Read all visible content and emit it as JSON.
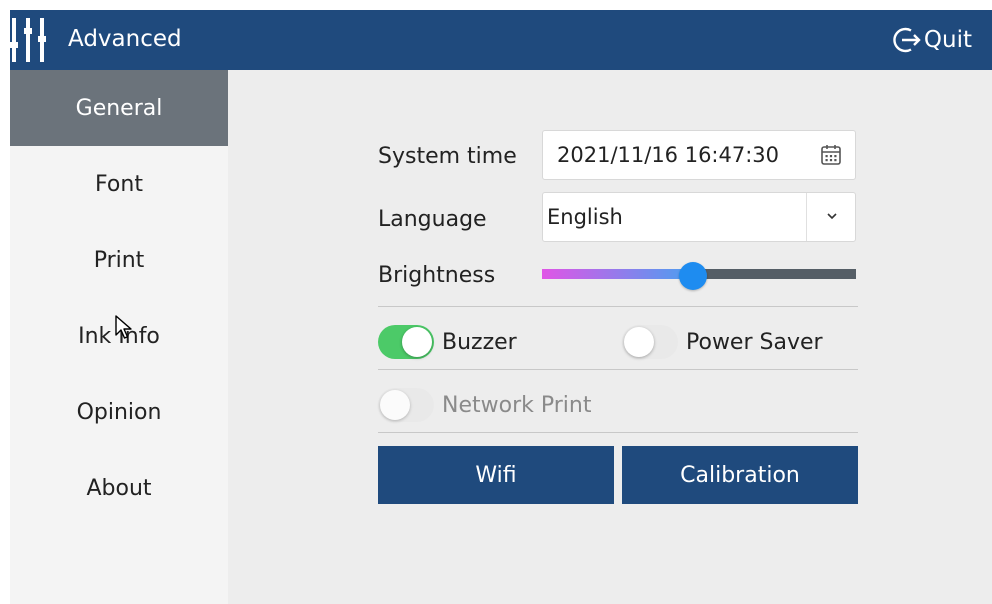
{
  "titlebar": {
    "title": "Advanced",
    "app_icon": "sliders-icon",
    "quit_icon": "logout-arrow-icon",
    "quit_label": "Quit",
    "bg_color": "#1f4a7d"
  },
  "sidebar": {
    "items": [
      {
        "label": "General",
        "active": true
      },
      {
        "label": "Font",
        "active": false
      },
      {
        "label": "Print",
        "active": false
      },
      {
        "label": "Ink Info",
        "active": false
      },
      {
        "label": "Opinion",
        "active": false
      },
      {
        "label": "About",
        "active": false
      }
    ],
    "active_color": "#6b737b"
  },
  "settings": {
    "system_time": {
      "label": "System time",
      "value": "2021/11/16 16:47:30",
      "icon": "calendar-icon"
    },
    "language": {
      "label": "Language",
      "value": "English",
      "icon": "chevron-down-icon"
    },
    "brightness": {
      "label": "Brightness",
      "value_percent": 48
    },
    "buzzer": {
      "label": "Buzzer",
      "on": true
    },
    "power_saver": {
      "label": "Power Saver",
      "on": false
    },
    "network_print": {
      "label": "Network Print",
      "on": false,
      "disabled": true
    }
  },
  "buttons": {
    "wifi": "Wifi",
    "calibration": "Calibration",
    "color": "#1f4a7d"
  },
  "colors": {
    "toggle_on": "#4cca68",
    "slider_thumb": "#1e8cf0"
  }
}
